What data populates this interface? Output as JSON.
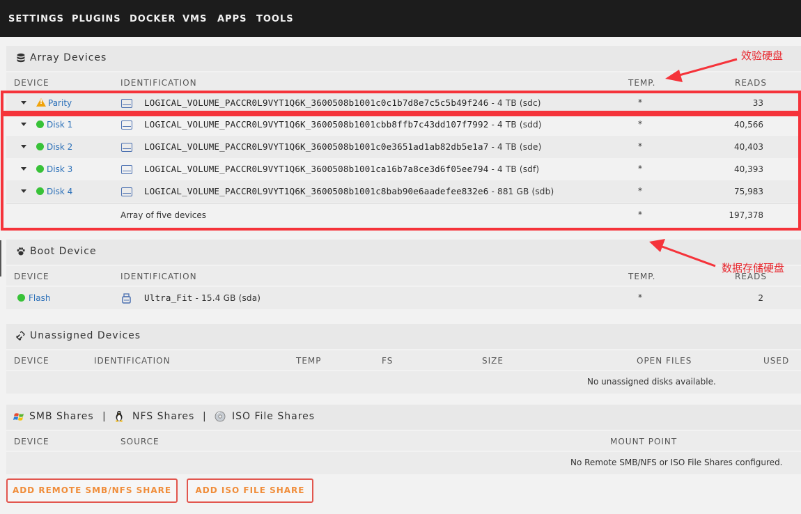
{
  "nav": [
    "SETTINGS",
    "PLUGINS",
    "DOCKER",
    "VMS",
    "APPS",
    "TOOLS"
  ],
  "array": {
    "title": "Array Devices",
    "cols": {
      "device": "DEVICE",
      "identification": "IDENTIFICATION",
      "temp": "TEMP.",
      "reads": "READS"
    },
    "rows": [
      {
        "device": "Parity",
        "status": "warning",
        "id": "LOGICAL_VOLUME_PACCR0L9VYT1Q6K_3600508b1001c0c1b7d8e7c5c5b49f246",
        "size": " - 4 TB (sdc)",
        "temp": "*",
        "reads": "33"
      },
      {
        "device": "Disk 1",
        "status": "ok",
        "id": "LOGICAL_VOLUME_PACCR0L9VYT1Q6K_3600508b1001cbb8ffb7c43dd107f7992",
        "size": " - 4 TB (sdd)",
        "temp": "*",
        "reads": "40,566"
      },
      {
        "device": "Disk 2",
        "status": "ok",
        "id": "LOGICAL_VOLUME_PACCR0L9VYT1Q6K_3600508b1001c0e3651ad1ab82db5e1a7",
        "size": " - 4 TB (sde)",
        "temp": "*",
        "reads": "40,403"
      },
      {
        "device": "Disk 3",
        "status": "ok",
        "id": "LOGICAL_VOLUME_PACCR0L9VYT1Q6K_3600508b1001ca16b7a8ce3d6f05ee794",
        "size": " - 4 TB (sdf)",
        "temp": "*",
        "reads": "40,393"
      },
      {
        "device": "Disk 4",
        "status": "ok",
        "id": "LOGICAL_VOLUME_PACCR0L9VYT1Q6K_3600508b1001c8bab90e6aadefee832e6",
        "size": " - 881 GB (sdb)",
        "temp": "*",
        "reads": "75,983"
      }
    ],
    "summary": {
      "label": "Array of five devices",
      "temp": "*",
      "reads": "197,378"
    }
  },
  "boot": {
    "title": "Boot Device",
    "cols": {
      "device": "DEVICE",
      "identification": "IDENTIFICATION",
      "temp": "TEMP.",
      "reads": "READS"
    },
    "row": {
      "device": "Flash",
      "id": "Ultra_Fit",
      "size": " - 15.4 GB (sda)",
      "temp": "*",
      "reads": "2"
    }
  },
  "unassigned": {
    "title": "Unassigned Devices",
    "cols": {
      "device": "DEVICE",
      "identification": "IDENTIFICATION",
      "temp": "TEMP",
      "fs": "FS",
      "size": "SIZE",
      "open_files": "OPEN FILES",
      "used": "USED"
    },
    "empty": "No unassigned disks available."
  },
  "shares": {
    "smb": "SMB Shares",
    "sep": "|",
    "nfs": "NFS Shares",
    "iso": "ISO File Shares",
    "cols": {
      "device": "DEVICE",
      "source": "SOURCE",
      "mount": "MOUNT POINT"
    },
    "empty": "No Remote SMB/NFS or ISO File Shares configured."
  },
  "buttons": {
    "add_remote": "ADD REMOTE SMB/NFS SHARE",
    "add_iso": "ADD ISO FILE SHARE"
  },
  "annotations": {
    "parity_note": "效验硬盘",
    "data_note": "数据存储硬盘"
  },
  "colors": {
    "accent": "#f08d3a",
    "annotation": "#f5333a",
    "ok": "#38c238",
    "warning": "#f0a30a",
    "link": "#2a6fb8"
  }
}
